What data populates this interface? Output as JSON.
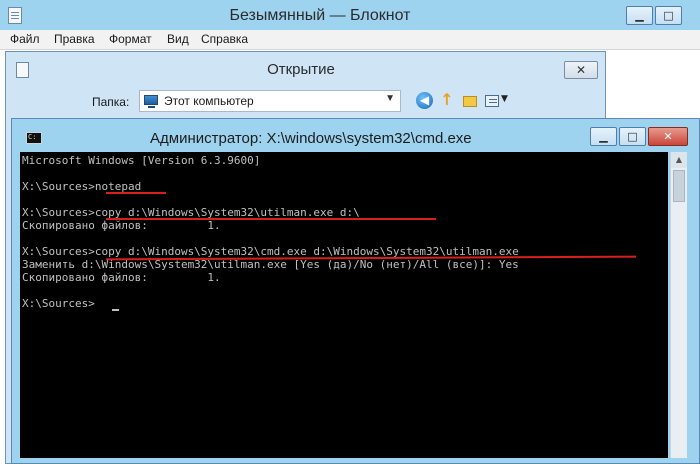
{
  "notepad": {
    "title": "Безымянный — Блокнот",
    "controls": {
      "minimize": "▁",
      "maximize": "□",
      "close": "✕"
    },
    "menu": [
      "Файл",
      "Правка",
      "Формат",
      "Вид",
      "Справка"
    ]
  },
  "open_dialog": {
    "title": "Открытие",
    "close": "✕",
    "folder_label": "Папка:",
    "folder_value": "Этот компьютер",
    "icons": [
      "back-icon",
      "up-folder-icon",
      "new-folder-icon",
      "view-menu-icon"
    ]
  },
  "cmd": {
    "title": "Администратор: X:\\windows\\system32\\cmd.exe",
    "controls": {
      "minimize": "▁",
      "maximize": "□",
      "close": "✕"
    },
    "lines": [
      "Microsoft Windows [Version 6.3.9600]",
      "",
      "X:\\Sources>notepad",
      "",
      "X:\\Sources>copy d:\\Windows\\System32\\utilman.exe d:\\",
      "Скопировано файлов:         1.",
      "",
      "X:\\Sources>copy d:\\Windows\\System32\\cmd.exe d:\\Windows\\System32\\utilman.exe",
      "Заменить d:\\Windows\\System32\\utilman.exe [Yes (да)/No (нет)/All (все)]: Yes",
      "Скопировано файлов:         1.",
      "",
      "X:\\Sources>"
    ],
    "highlight_color": "#d8201a"
  }
}
